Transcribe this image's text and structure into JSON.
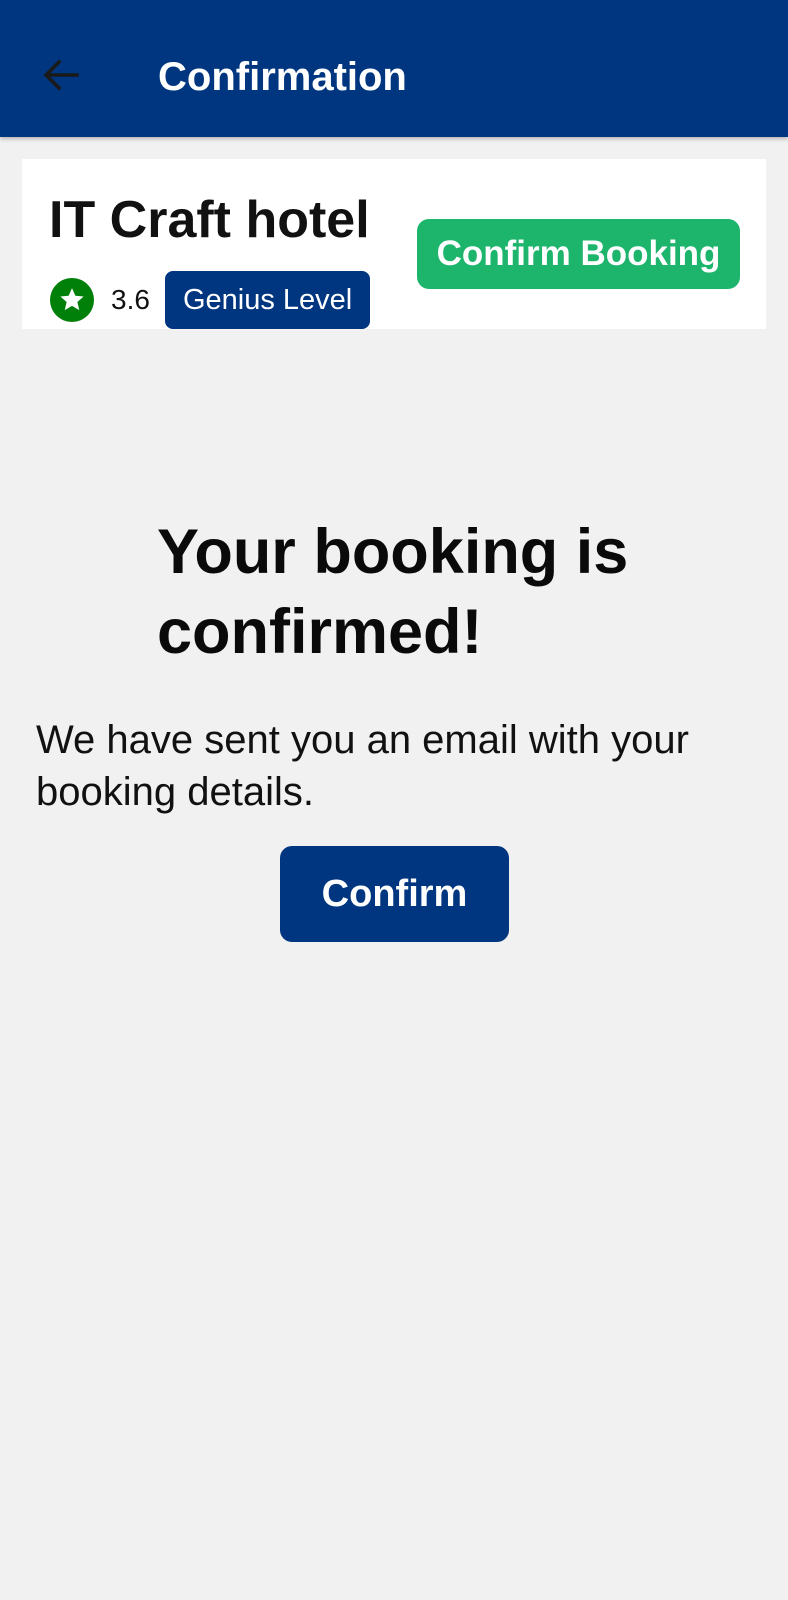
{
  "app_bar": {
    "title": "Confirmation",
    "back_icon": "arrow-left-icon",
    "background_color": "#003580"
  },
  "hotel": {
    "name": "IT Craft hotel",
    "rating": "3.6",
    "rating_icon": "star-icon",
    "rating_color": "#008009",
    "badge": "Genius Level",
    "confirm_booking_label": "Confirm Booking",
    "confirm_booking_color": "#1db46c"
  },
  "main": {
    "heading": "Your booking is confirmed!",
    "message": "We have sent you an email with your booking details.",
    "confirm_label": "Confirm",
    "confirm_color": "#003580"
  }
}
